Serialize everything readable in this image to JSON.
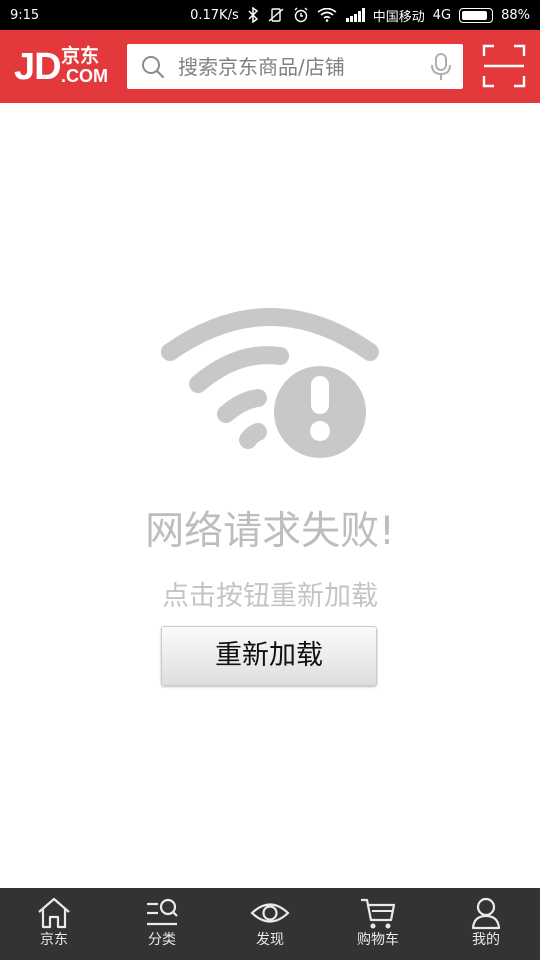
{
  "status_bar": {
    "time": "9:15",
    "speed": "0.17K/s",
    "carrier": "中国移动",
    "network": "4G",
    "battery_percent": "88%",
    "battery_level": 0.88
  },
  "header": {
    "logo_letters": "JD",
    "logo_chinese": "京东",
    "logo_domain": ".COM",
    "search_placeholder": "搜索京东商品/店铺",
    "brand_color": "#e4393c"
  },
  "error": {
    "title": "网络请求失败!",
    "subtitle": "点击按钮重新加载",
    "reload_label": "重新加载"
  },
  "bottom_nav": {
    "items": [
      {
        "label": "京东",
        "icon": "home-icon"
      },
      {
        "label": "分类",
        "icon": "category-search-icon"
      },
      {
        "label": "发现",
        "icon": "eye-icon"
      },
      {
        "label": "购物车",
        "icon": "cart-icon"
      },
      {
        "label": "我的",
        "icon": "user-icon"
      }
    ]
  }
}
